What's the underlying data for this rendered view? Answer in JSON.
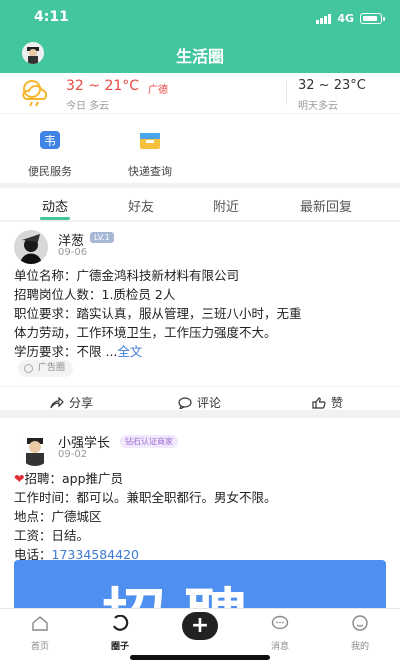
{
  "status_bar": {
    "time": "4:11",
    "network": "4G"
  },
  "header": {
    "title": "生活圈"
  },
  "weather": {
    "today_temp": "32 ~ 21°C",
    "city": "广德",
    "today_label": "今日 多云",
    "tomorrow_temp": "32 ~ 23°C",
    "tomorrow_label": "明天多云"
  },
  "services": [
    {
      "label": "便民服务",
      "icon": "convenience-service-icon"
    },
    {
      "label": "快递查询",
      "icon": "express-query-icon"
    }
  ],
  "tabs": [
    "动态",
    "好友",
    "附近",
    "最新回复"
  ],
  "post1": {
    "name": "洋葱",
    "level": "LV.1",
    "date": "09-06",
    "lines": [
      "单位名称：广德金鸿科技新材料有限公司",
      "招聘岗位人数：1.质检员 2人",
      "职位要求：踏实认真，服从管理，三班八小时，无重",
      "体力劳动，工作环境卫生，工作压力强度不大。",
      "学历要求：不限 ..."
    ],
    "more": "全文",
    "tag": "广告圈",
    "actions": {
      "share": "分享",
      "comment": "评论",
      "like": "赞"
    }
  },
  "post2": {
    "name": "小强学长",
    "badge": "钻石认证商家",
    "date": "09-02",
    "lines": [
      "招聘：app推广员",
      "工作时间：都可以。兼职全职都行。男女不限。",
      "地点：广德城区",
      "工资：日结。",
      "电话："
    ],
    "phone": "17334584420",
    "banner_text": "招聘"
  },
  "tabbar": {
    "home": "首页",
    "circle": "圈子",
    "publish": "+",
    "messages": "消息",
    "mine": "我的"
  },
  "colors": {
    "brand": "#43c59e",
    "temp": "#e64a45",
    "link": "#3b7bd6"
  }
}
